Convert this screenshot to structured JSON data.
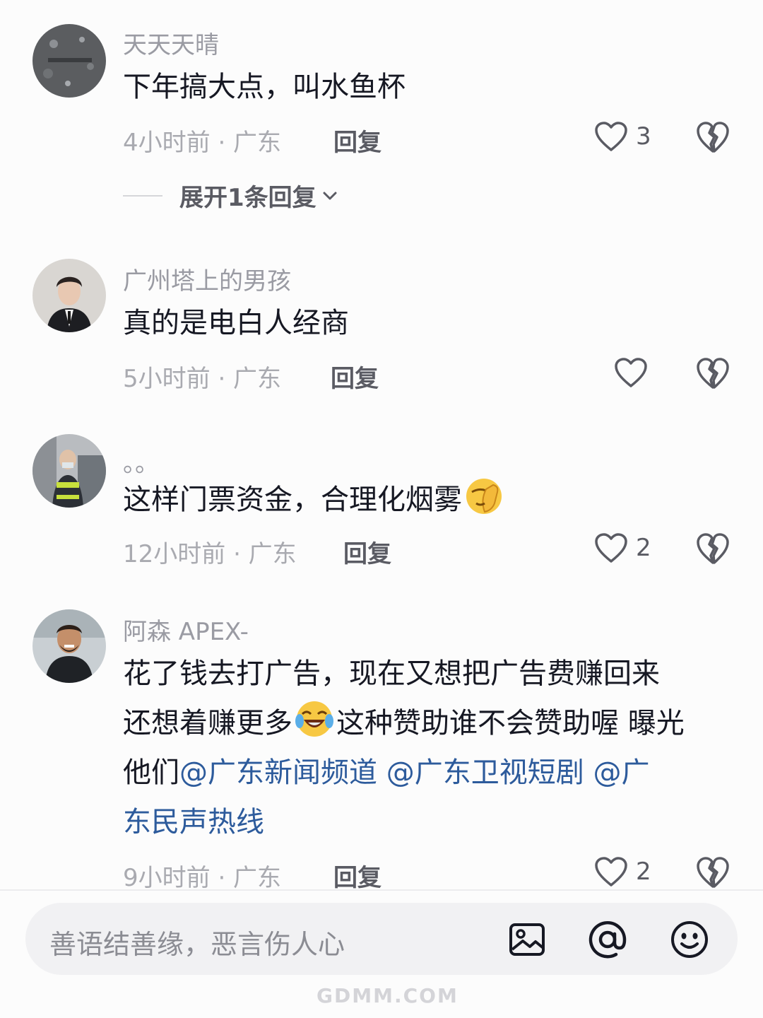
{
  "comments": [
    {
      "username": "天天天晴",
      "text": "下年搞大点，叫水鱼杯",
      "time_location": "4小时前 · 广东",
      "reply_label": "回复",
      "likes": "3",
      "expand_label": "展开1条回复"
    },
    {
      "username": "广州塔上的男孩",
      "text": "真的是电白人经商",
      "time_location": "5小时前 · 广东",
      "reply_label": "回复",
      "likes": ""
    },
    {
      "username": "。。",
      "text": "这样门票资金，合理化烟雾",
      "emoji": "facepalm-emoji",
      "time_location": "12小时前 · 广东",
      "reply_label": "回复",
      "likes": "2"
    },
    {
      "username": "阿森 APEX-",
      "line1": "花了钱去打广告，现在又想把广告费赚回来",
      "line2a": "还想着赚更多",
      "emoji": "laughing-crying-emoji",
      "line2b": "这种赞助谁不会赞助喔 曝光",
      "line3a": "他们",
      "mention1": "@广东新闻频道",
      "mention2": "@广东卫视短剧",
      "mention3a": "@广",
      "mention3b": "东民声热线",
      "time_location": "9小时前 · 广东",
      "reply_label": "回复",
      "likes": "2"
    }
  ],
  "input_bar": {
    "placeholder": "善语结善缘，恶言伤人心",
    "icons": [
      "image-icon",
      "at-icon",
      "emoji-icon"
    ]
  },
  "watermark": "GDMM.COM",
  "colors": {
    "mention": "#2d5b9c",
    "muted": "#a9aab0",
    "username": "#9a9ba3",
    "text": "#161823"
  }
}
